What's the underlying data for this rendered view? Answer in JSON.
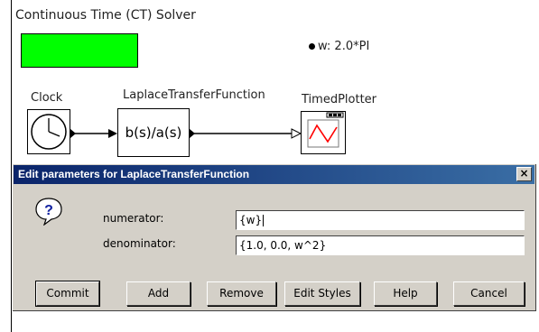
{
  "diagram": {
    "director_label": "Continuous Time (CT) Solver",
    "parameter_text": "w: 2.0*PI",
    "actors": {
      "clock_label": "Clock",
      "laplace_label": "LaplaceTransferFunction",
      "laplace_expression": "b(s)/a(s)",
      "plotter_label": "TimedPlotter"
    },
    "colors": {
      "director_fill": "#00ff00",
      "dialog_title_bar": "#0a246a",
      "dialog_background": "#d4d0c8"
    }
  },
  "dialog": {
    "title": "Edit parameters for LaplaceTransferFunction",
    "close_glyph": "×",
    "icon": "question-icon",
    "fields": {
      "numerator_label": "numerator:",
      "numerator_value": "{w}",
      "denominator_label": "denominator:",
      "denominator_value": "{1.0, 0.0, w^2}"
    },
    "buttons": {
      "commit": "Commit",
      "add": "Add",
      "remove": "Remove",
      "edit_styles": "Edit Styles",
      "help": "Help",
      "cancel": "Cancel"
    }
  }
}
